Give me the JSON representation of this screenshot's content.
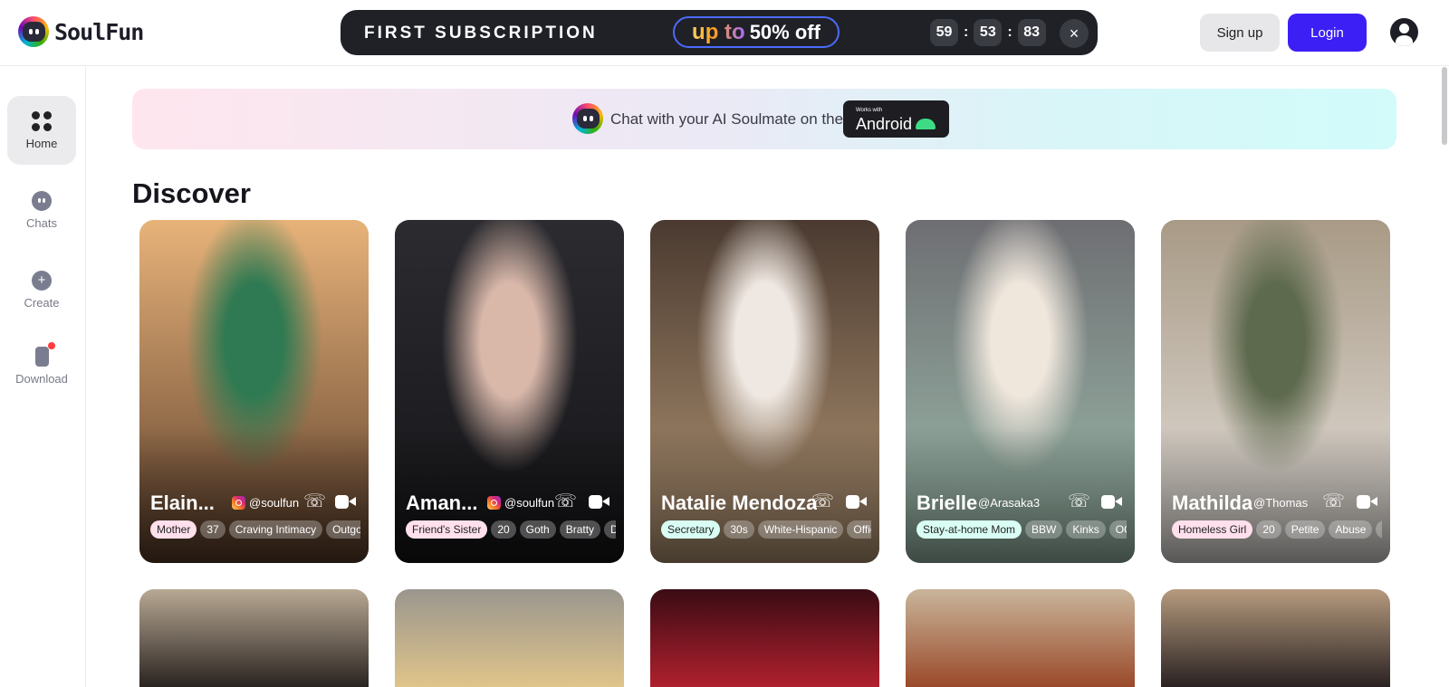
{
  "brand": {
    "name": "SoulFun",
    "logo_icon": "soulfun-logo-icon"
  },
  "promo": {
    "title": "FIRST SUBSCRIPTION",
    "offer_prefix": "up to",
    "offer_value": "50% off",
    "timer": {
      "h": "59",
      "sep1": ":",
      "m": "53",
      "sep2": ":",
      "s": "83"
    },
    "close_label": "×"
  },
  "header": {
    "signup_label": "Sign up",
    "login_label": "Login",
    "account_icon": "user-circle-icon"
  },
  "sidebar": {
    "items": [
      {
        "label": "Home",
        "icon": "grid-icon",
        "active": true
      },
      {
        "label": "Chats",
        "icon": "chat-bubble-icon",
        "active": false
      },
      {
        "label": "Create",
        "icon": "plus-circle-icon",
        "active": false
      },
      {
        "label": "Download",
        "icon": "phone-icon",
        "active": false,
        "badge": true
      }
    ]
  },
  "banner": {
    "text": "Chat with your AI Soulmate on the",
    "badge_small": "Works with",
    "badge_big": "Android"
  },
  "section_title": "Discover",
  "cards": [
    {
      "name": "Elain...",
      "handle": "@soulfun",
      "instagram": true,
      "tags": [
        "Mother",
        "37",
        "Craving Intimacy",
        "Outgoing"
      ],
      "colors": [
        "#e8b37a",
        "#2f7a52",
        "#5a3d2a"
      ]
    },
    {
      "name": "Aman...",
      "handle": "@soulfun",
      "instagram": true,
      "tags": [
        "Friend's Sister",
        "20",
        "Goth",
        "Bratty",
        "De"
      ],
      "colors": [
        "#2b2b30",
        "#d9b8aa",
        "#151518"
      ]
    },
    {
      "name": "Natalie Mendoza",
      "handle": "",
      "instagram": false,
      "tags": [
        "Secretary",
        "30s",
        "White-Hispanic",
        "Office"
      ],
      "colors": [
        "#4a3a30",
        "#efe8e2",
        "#b89a78"
      ]
    },
    {
      "name": "Brielle",
      "handle": "@Arasaka3",
      "instagram": false,
      "tags": [
        "Stay-at-home Mom",
        "BBW",
        "Kinks",
        "OCI"
      ],
      "colors": [
        "#6e6e72",
        "#efe6dc",
        "#9fbfae"
      ]
    },
    {
      "name": "Mathilda",
      "handle": "@Thomas",
      "instagram": false,
      "tags": [
        "Homeless Girl",
        "20",
        "Petite",
        "Abuse",
        "P"
      ],
      "colors": [
        "#a89a86",
        "#5e6a4e",
        "#e8e4e0"
      ]
    }
  ],
  "second_row": [
    {
      "colors": [
        "#b8a894",
        "#2a2420"
      ]
    },
    {
      "colors": [
        "#9a968e",
        "#e0c48a"
      ]
    },
    {
      "colors": [
        "#3a0c14",
        "#b0202e"
      ]
    },
    {
      "colors": [
        "#c9b59b",
        "#9a4a2a"
      ]
    },
    {
      "colors": [
        "#b69a7e",
        "#2a2222"
      ]
    }
  ]
}
